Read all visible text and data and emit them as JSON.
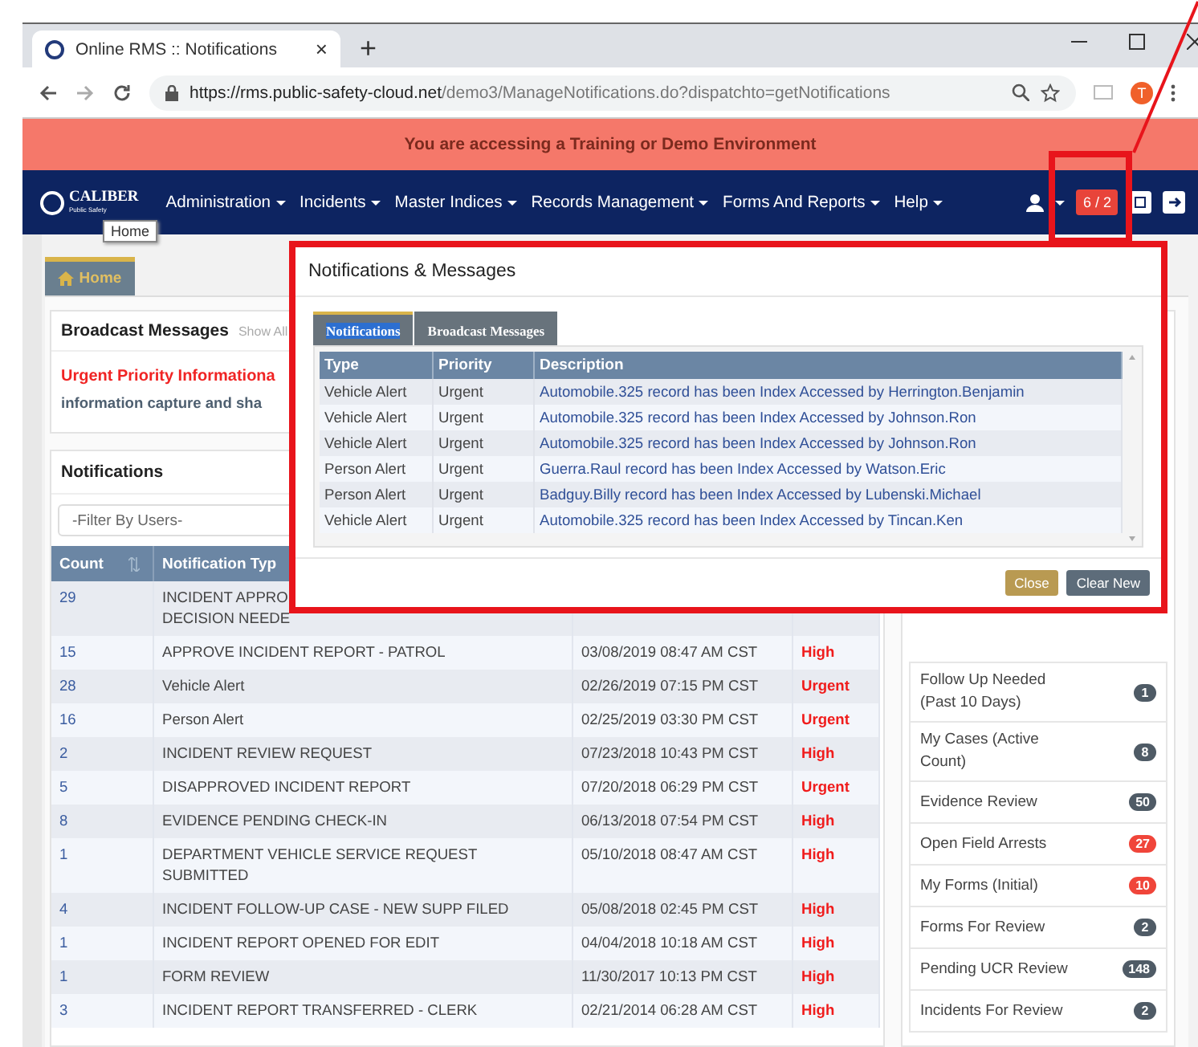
{
  "browser": {
    "tab_title": "Online RMS :: Notifications",
    "tab_close": "×",
    "new_tab": "+",
    "url_host": "https://rms.public-safety-cloud.net",
    "url_path": "/demo3/ManageNotifications.do?dispatchto=getNotifications",
    "profile_initial": "T"
  },
  "banner": "You are accessing a Training or Demo Environment",
  "navbar": {
    "logo": "CALIBER",
    "logo_sub": "Public Safety",
    "menu": [
      "Administration",
      "Incidents",
      "Master Indices",
      "Records Management",
      "Forms And Reports",
      "Help"
    ],
    "alert_badge": "6 / 2",
    "tooltip": "Home"
  },
  "home_tab": "Home",
  "broadcast": {
    "title": "Broadcast Messages",
    "show_all": "Show All",
    "lines": [
      {
        "kind": "urgent",
        "text": "Urgent Priority Informationa"
      },
      {
        "kind": "body",
        "text": "information capture and sha"
      }
    ]
  },
  "notifications": {
    "title": "Notifications",
    "filter_placeholder": "-Filter By Users-",
    "columns": [
      {
        "label": "Count",
        "sortable": true
      },
      {
        "label": "Notification Typ"
      }
    ],
    "rows": [
      {
        "count": "29",
        "type": "INCIDENT APPRO\nDECISION NEEDE",
        "date": "",
        "priority": ""
      },
      {
        "count": "15",
        "type": "APPROVE INCIDENT REPORT - PATROL",
        "date": "03/08/2019 08:47 AM CST",
        "priority": "High"
      },
      {
        "count": "28",
        "type": "Vehicle Alert",
        "date": "02/26/2019 07:15 PM CST",
        "priority": "Urgent"
      },
      {
        "count": "16",
        "type": "Person Alert",
        "date": "02/25/2019 03:30 PM CST",
        "priority": "Urgent"
      },
      {
        "count": "2",
        "type": "INCIDENT REVIEW REQUEST",
        "date": "07/23/2018 10:43 PM CST",
        "priority": "High"
      },
      {
        "count": "5",
        "type": "DISAPPROVED INCIDENT REPORT",
        "date": "07/20/2018 06:29 PM CST",
        "priority": "Urgent"
      },
      {
        "count": "8",
        "type": "EVIDENCE PENDING CHECK-IN",
        "date": "06/13/2018 07:54 PM CST",
        "priority": "High"
      },
      {
        "count": "1",
        "type": "DEPARTMENT VEHICLE SERVICE REQUEST\nSUBMITTED",
        "date": "05/10/2018 08:47 AM CST",
        "priority": "High"
      },
      {
        "count": "4",
        "type": "INCIDENT FOLLOW-UP CASE - NEW SUPP FILED",
        "date": "05/08/2018 02:45 PM CST",
        "priority": "High"
      },
      {
        "count": "1",
        "type": "INCIDENT REPORT OPENED FOR EDIT",
        "date": "04/04/2018 10:18 AM CST",
        "priority": "High"
      },
      {
        "count": "1",
        "type": "FORM REVIEW",
        "date": "11/30/2017 10:13 PM CST",
        "priority": "High"
      },
      {
        "count": "3",
        "type": "INCIDENT REPORT TRANSFERRED - CLERK",
        "date": "02/21/2014 06:28 AM CST",
        "priority": "High"
      }
    ]
  },
  "sidebar": {
    "items": [
      {
        "label": "Follow Up Needed (Past 10 Days)",
        "count": "1",
        "color": "#4f5b66"
      },
      {
        "label": "My Cases (Active Count)",
        "count": "8",
        "color": "#4f5b66"
      },
      {
        "label": "Evidence Review",
        "count": "50",
        "color": "#4f5b66"
      },
      {
        "label": "Open Field Arrests",
        "count": "27",
        "color": "#f0453a"
      },
      {
        "label": "My Forms (Initial)",
        "count": "10",
        "color": "#f0453a"
      },
      {
        "label": "Forms For Review",
        "count": "2",
        "color": "#4f5b66"
      },
      {
        "label": "Pending UCR Review",
        "count": "148",
        "color": "#4f5b66"
      },
      {
        "label": "Incidents For Review",
        "count": "2",
        "color": "#4f5b66"
      }
    ]
  },
  "modal": {
    "title": "Notifications & Messages",
    "tabs": [
      {
        "label": "Notifications",
        "selected": true
      },
      {
        "label": "Broadcast Messages",
        "selected": false
      }
    ],
    "columns": [
      "Type",
      "Priority",
      "Description"
    ],
    "rows": [
      {
        "type": "Vehicle Alert",
        "priority": "Urgent",
        "description": "Automobile.325 record has been Index Accessed by Herrington.Benjamin"
      },
      {
        "type": "Vehicle Alert",
        "priority": "Urgent",
        "description": "Automobile.325 record has been Index Accessed by Johnson.Ron"
      },
      {
        "type": "Vehicle Alert",
        "priority": "Urgent",
        "description": "Automobile.325 record has been Index Accessed by Johnson.Ron"
      },
      {
        "type": "Person Alert",
        "priority": "Urgent",
        "description": "Guerra.Raul record has been Index Accessed by Watson.Eric"
      },
      {
        "type": "Person Alert",
        "priority": "Urgent",
        "description": "Badguy.Billy record has been Index Accessed by Lubenski.Michael"
      },
      {
        "type": "Vehicle Alert",
        "priority": "Urgent",
        "description": "Automobile.325 record has been Index Accessed by Tincan.Ken"
      }
    ],
    "buttons": [
      {
        "label": "Close",
        "kind": "accent"
      },
      {
        "label": "Clear New",
        "kind": "default"
      }
    ]
  }
}
